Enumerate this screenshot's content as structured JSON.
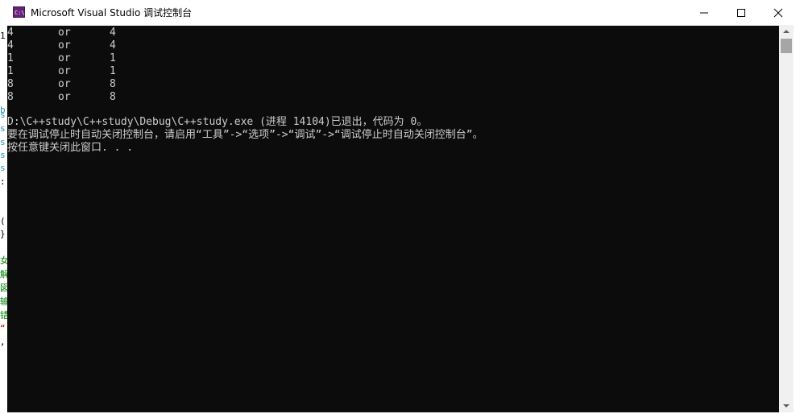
{
  "window": {
    "title": "Microsoft Visual Studio 调试控制台",
    "icon": "visual-studio-console-icon",
    "buttons": {
      "minimize": "minimize-icon",
      "maximize": "maximize-icon",
      "close": "close-icon"
    },
    "colors": {
      "console_bg": "#0c0c0c",
      "console_text": "#cccccc",
      "titlebar_bg": "#ffffff"
    }
  },
  "console": {
    "rows": [
      {
        "a": "4",
        "op": "or",
        "b": "4"
      },
      {
        "a": "4",
        "op": "or",
        "b": "4"
      },
      {
        "a": "1",
        "op": "or",
        "b": "1"
      },
      {
        "a": "1",
        "op": "or",
        "b": "1"
      },
      {
        "a": "8",
        "op": "or",
        "b": "8"
      },
      {
        "a": "8",
        "op": "or",
        "b": "8"
      }
    ],
    "exit_line": "D:\\C++study\\C++study\\Debug\\C++study.exe (进程 14104)已退出，代码为 0。",
    "hint_line": "要在调试停止时自动关闭控制台，请启用“工具”->“选项”->“调试”->“调试停止时自动关闭控制台”。",
    "press_key_line": "按任意键关闭此窗口. . ."
  },
  "background_ide": {
    "chars": [
      "1",
      "b",
      "s",
      "s",
      "s",
      "s",
      "s",
      ":",
      "(",
      "}",
      "女",
      "解",
      "図",
      "输",
      "错",
      "“",
      ","
    ]
  }
}
